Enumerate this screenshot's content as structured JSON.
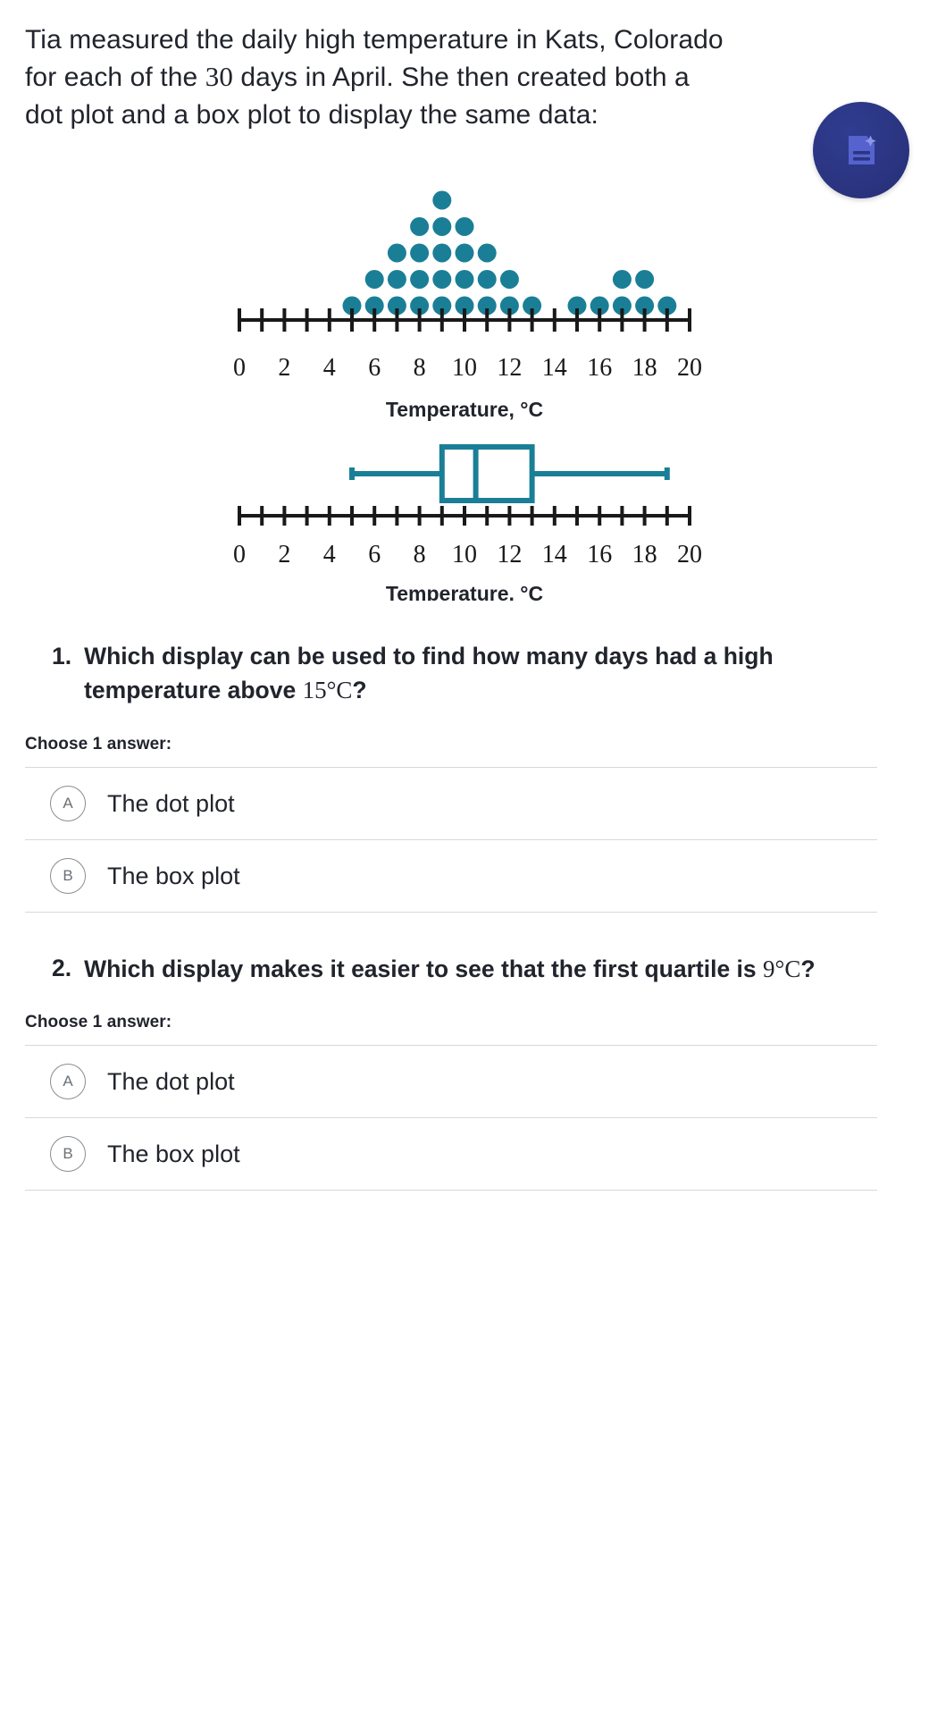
{
  "prompt": {
    "line1": "Tia measured the daily high temperature in Kats, Colorado",
    "line2_a": "for each of the ",
    "line2_num": "30",
    "line2_b": " days in April. She then created both a",
    "line3": "dot plot and a box plot to display the same data:"
  },
  "badge": {
    "icon": "document-sparkle-icon",
    "color": "#2b3582"
  },
  "chart_data": [
    {
      "type": "scatter",
      "name": "dot-plot",
      "title": "",
      "xlabel": "Temperature, °C",
      "ylabel": "",
      "xlim": [
        0,
        20
      ],
      "tick_step": 1,
      "tick_labels": [
        "0",
        "2",
        "4",
        "6",
        "8",
        "10",
        "12",
        "14",
        "16",
        "18",
        "20"
      ],
      "tick_label_values": [
        0,
        2,
        4,
        6,
        8,
        10,
        12,
        14,
        16,
        18,
        20
      ],
      "grid": false,
      "dot_color": "#1a7f96",
      "categories": [
        5,
        6,
        7,
        8,
        9,
        10,
        11,
        12,
        13,
        14,
        15,
        16,
        17,
        18,
        19
      ],
      "values": [
        1,
        2,
        3,
        4,
        5,
        4,
        3,
        2,
        1,
        0,
        1,
        1,
        2,
        2,
        1
      ],
      "total_dots": 30,
      "axis_color": "#191919"
    },
    {
      "type": "box",
      "name": "box-plot",
      "title": "",
      "xlabel": "Temperature, °C",
      "xlim": [
        0,
        20
      ],
      "tick_step": 1,
      "tick_labels": [
        "0",
        "2",
        "4",
        "6",
        "8",
        "10",
        "12",
        "14",
        "16",
        "18",
        "20"
      ],
      "tick_label_values": [
        0,
        2,
        4,
        6,
        8,
        10,
        12,
        14,
        16,
        18,
        20
      ],
      "grid": false,
      "box_color": "#1a7f96",
      "min": 5,
      "q1": 9,
      "median": 10.5,
      "q3": 13,
      "max": 19,
      "axis_color": "#191919"
    }
  ],
  "questions": [
    {
      "number": "1.",
      "text_a": "Which display can be used to find how many days had a high temperature above ",
      "text_num": "15°C",
      "text_b": "?",
      "choose_label": "Choose 1 answer:",
      "options": [
        {
          "letter": "A",
          "label": "The dot plot"
        },
        {
          "letter": "B",
          "label": "The box plot"
        }
      ]
    },
    {
      "number": "2.",
      "text_a": "Which display makes it easier to see that the first quartile is ",
      "text_num": "9°C",
      "text_b": "?",
      "choose_label": "Choose 1 answer:",
      "options": [
        {
          "letter": "A",
          "label": "The dot plot"
        },
        {
          "letter": "B",
          "label": "The box plot"
        }
      ]
    }
  ]
}
